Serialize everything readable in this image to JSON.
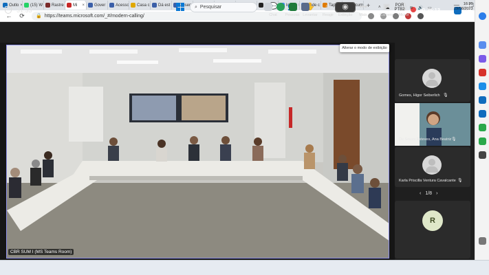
{
  "browser": {
    "tabs": [
      {
        "label": "Outlo",
        "color": "#0f6cbd"
      },
      {
        "label": "(15) W",
        "color": "#25d366"
      },
      {
        "label": "Rastre",
        "color": "#7a2b2b"
      },
      {
        "label": "Mi",
        "color": "#c62828",
        "active": true
      },
      {
        "label": "Gover",
        "color": "#3b5fa8"
      },
      {
        "label": "Acesso",
        "color": "#3b5fa8"
      },
      {
        "label": "Casa c",
        "color": "#e0a800"
      },
      {
        "label": "Dá est",
        "color": "#3b5fa8"
      },
      {
        "label": "Desen",
        "color": "#3b5fa8"
      },
      {
        "label": "Acess",
        "color": "#3b5fa8"
      },
      {
        "label": "Email",
        "color": "#3b5fa8"
      },
      {
        "label": "ChatG",
        "color": "#10a37f"
      },
      {
        "label": "Sketch",
        "color": "#222222"
      },
      {
        "label": "loja tc",
        "color": "#4285f4"
      },
      {
        "label": "onde c",
        "color": "#4285f4"
      },
      {
        "label": "Tapete",
        "color": "#e07b00"
      },
      {
        "label": "Docum",
        "color": "#2b579a"
      }
    ],
    "url": "https://teams.microsoft.com/_#/modern-calling/"
  },
  "teams": {
    "elapsed": "31:33",
    "toolbar": [
      {
        "label": "Chat",
        "icon": "chat-icon"
      },
      {
        "label": "Pessoas",
        "icon": "people-icon"
      },
      {
        "label": "Levantar",
        "icon": "raise-hand-icon"
      },
      {
        "label": "Reagir",
        "icon": "react-icon"
      },
      {
        "label": "Exibição",
        "icon": "view-icon"
      },
      {
        "label": "Mais",
        "icon": "more-icon"
      },
      {
        "label": "Câmera",
        "icon": "camera-icon"
      },
      {
        "label": "Microf",
        "icon": "mic-icon"
      }
    ],
    "recording_time": "00:25:13",
    "tooltip": "Alterar o modo de exibição",
    "room_label": "CBR SUM I (MS Teams Room)",
    "participants": [
      {
        "name": "Gomes, Higor Seiberlich"
      },
      {
        "name": "De Souza Esteves, Ana Beatriz"
      },
      {
        "name": "Karla Priscilla Ventura Cavalcante"
      }
    ],
    "pager": "1/8",
    "initial": "R"
  },
  "taskbar": {
    "search_placeholder": "Pesquisar",
    "lang_top": "POR",
    "lang_bottom": "PTB2",
    "time": "16:31",
    "date": "19/06/2023"
  }
}
